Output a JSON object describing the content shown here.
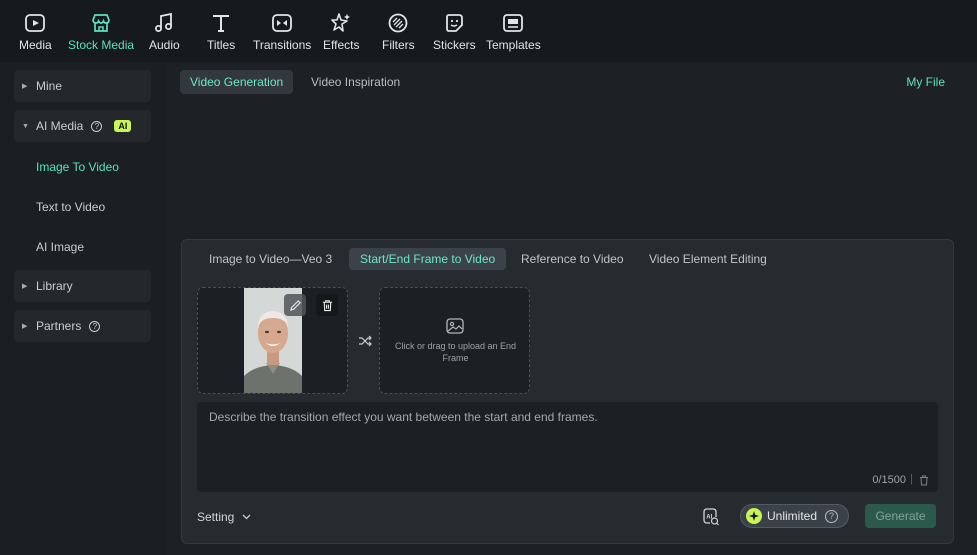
{
  "toolbar": {
    "items": [
      {
        "label": "Media",
        "icon": "media-icon"
      },
      {
        "label": "Stock Media",
        "icon": "store-icon"
      },
      {
        "label": "Audio",
        "icon": "music-note-icon"
      },
      {
        "label": "Titles",
        "icon": "title-t-icon"
      },
      {
        "label": "Transitions",
        "icon": "transitions-icon"
      },
      {
        "label": "Effects",
        "icon": "sparkle-star-icon"
      },
      {
        "label": "Filters",
        "icon": "filters-icon"
      },
      {
        "label": "Stickers",
        "icon": "sticker-smile-icon"
      },
      {
        "label": "Templates",
        "icon": "templates-icon"
      }
    ],
    "active": "Stock Media"
  },
  "sidebar": {
    "mine": "Mine",
    "ai_media": "AI Media",
    "ai_badge": "AI",
    "sub_items": [
      "Image To Video",
      "Text to Video",
      "AI Image"
    ],
    "active_sub": "Image To Video",
    "library": "Library",
    "partners": "Partners",
    "help_glyph": "?"
  },
  "main": {
    "tabs": [
      "Video Generation",
      "Video Inspiration"
    ],
    "active_tab": "Video Generation",
    "my_file": "My File",
    "panel": {
      "tabs": [
        "Image to Video—Veo 3",
        "Start/End Frame to Video",
        "Reference to Video",
        "Video Element Editing"
      ],
      "active_tab": "Start/End Frame to Video",
      "end_frame_upload": "Click or drag to upload an End Frame",
      "prompt_placeholder": "Describe the transition effect you want between the start and end frames.",
      "prompt_value": "",
      "counter": "0/1500",
      "setting_label": "Setting",
      "unlimited_label": "Unlimited",
      "help_glyph": "?",
      "generate_label": "Generate"
    }
  },
  "colors": {
    "accent": "#5ce1c0",
    "ai_badge": "#c8f557",
    "generate_bg": "#2b5a4d",
    "background": "#16191d"
  }
}
